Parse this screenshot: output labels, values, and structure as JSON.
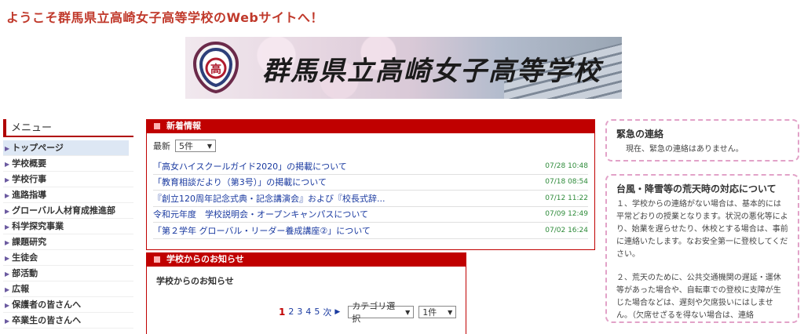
{
  "header": {
    "welcome": "ようこそ群馬県立高崎女子高等学校のWebサイトへ！",
    "school_name": "群馬県立高崎女子高等学校",
    "emblem_char": "高"
  },
  "menu": {
    "title": "メニュー",
    "items": [
      "トップページ",
      "学校概要",
      "学校行事",
      "進路指導",
      "グローバル人材育成推進部",
      "科学探究事業",
      "課題研究",
      "生徒会",
      "部活動",
      "広報",
      "保護者の皆さんへ",
      "卒業生の皆さんへ"
    ]
  },
  "news": {
    "title": "新着情報",
    "latest_label": "最新",
    "count_select": "5件",
    "items": [
      {
        "title": "「高女ハイスクールガイド2020」の掲載について",
        "date": "07/28 10:48"
      },
      {
        "title": "「教育相談だより（第3号）」の掲載について",
        "date": "07/18 08:54"
      },
      {
        "title": "『創立120周年記念式典・記念講演会』および『校長式辞...",
        "date": "07/12 11:22"
      },
      {
        "title": "令和元年度　学校説明会・オープンキャンパスについて",
        "date": "07/09 12:49"
      },
      {
        "title": "「第２学年 グローバル・リーダー養成講座②」について",
        "date": "07/02 16:24"
      }
    ]
  },
  "notice": {
    "title": "学校からのお知らせ",
    "heading": "学校からのお知らせ",
    "pages": [
      "1",
      "2",
      "3",
      "4",
      "5"
    ],
    "next_label": "次",
    "category_select": "カテゴリ選択",
    "count_select": "1件"
  },
  "emergency": {
    "title": "緊急の連絡",
    "text": "現在、緊急の連絡はありません。"
  },
  "typhoon": {
    "title": "台風・降雪等の荒天時の対応について",
    "para1": "１、学校からの連絡がない場合は、基本的には平常どおりの授業となります。状況の悪化等により、始業を遅らせたり、休校とする場合は、事前に連絡いたします。なお安全第一に登校してください。",
    "para2": "２、荒天のために、公共交通機関の遅延・運休等があった場合や、自転車での登校に支障が生じた場合などは、遅刻や欠席扱いにはしません。（欠席せざるを得ない場合は、連絡"
  }
}
